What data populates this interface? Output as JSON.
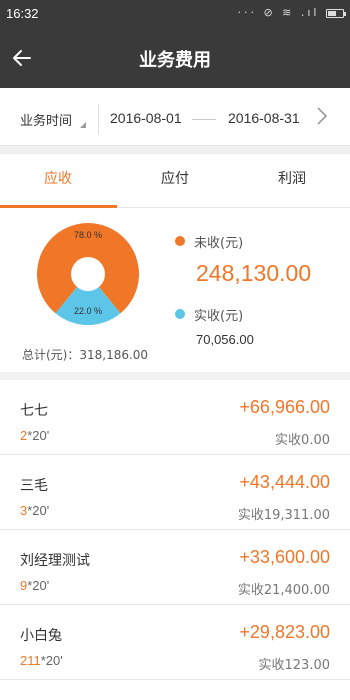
{
  "status_bar": {
    "time": "16:32",
    "icons": "··· ⊘ ≋ .ıl"
  },
  "header": {
    "back_icon": "arrow-left-icon",
    "title": "业务费用"
  },
  "filter": {
    "label": "业务时间",
    "start_date": "2016-08-01",
    "end_date": "2016-08-31",
    "next_icon": "chevron-right-icon"
  },
  "tabs": [
    {
      "label": "应收",
      "active": true
    },
    {
      "label": "应付",
      "active": false
    },
    {
      "label": "利润",
      "active": false
    }
  ],
  "summary": {
    "donut_unpaid_pct": 78.0,
    "donut_paid_pct": 22.0,
    "donut_unpaid_label": "78.0 %",
    "donut_paid_label": "22.0 %",
    "unpaid_label": "未收(元)",
    "unpaid_value": "248,130.00",
    "paid_label": "实收(元)",
    "paid_value": "70,056.00",
    "total_text": "总计(元)：318,186.00",
    "colors": {
      "unpaid": "#f07628",
      "paid": "#5bc6e8",
      "accent": "#f07628"
    }
  },
  "rows": [
    {
      "name": "七七",
      "count": "2",
      "suffix": "*20'",
      "amount": "+66,966.00",
      "paid": "实收0.00"
    },
    {
      "name": "三毛",
      "count": "3",
      "suffix": "*20'",
      "amount": "+43,444.00",
      "paid": "实收19,311.00"
    },
    {
      "name": "刘经理测试",
      "count": "9",
      "suffix": "*20'",
      "amount": "+33,600.00",
      "paid": "实收21,400.00"
    },
    {
      "name": "小白兔",
      "count": "211",
      "suffix": "*20'",
      "amount": "+29,823.00",
      "paid": "实收123.00"
    }
  ]
}
